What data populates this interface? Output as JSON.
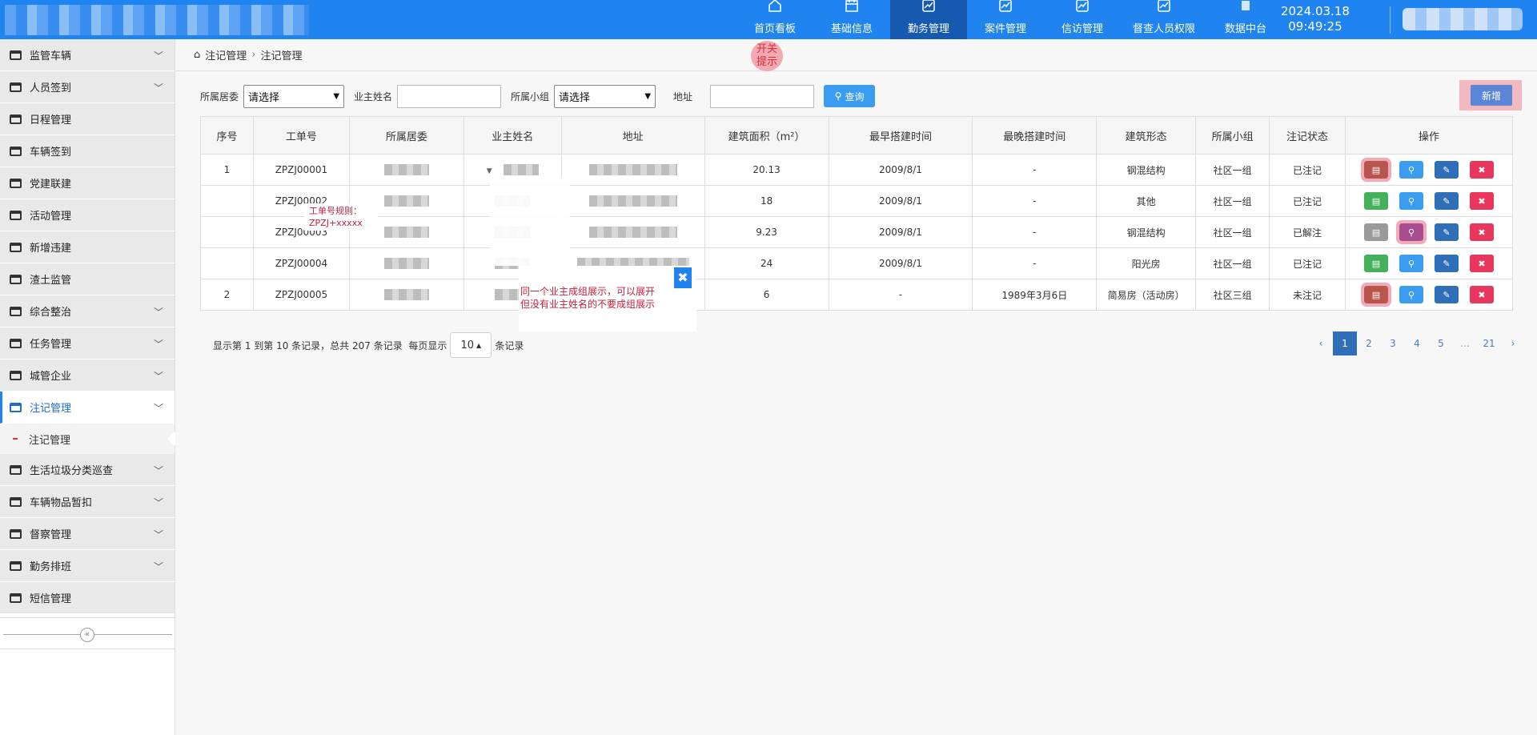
{
  "header": {
    "nav": [
      {
        "label": "首页看板",
        "icon": "home-icon"
      },
      {
        "label": "基础信息",
        "icon": "calendar-icon"
      },
      {
        "label": "勤务管理",
        "icon": "chart-icon",
        "active": true
      },
      {
        "label": "案件管理",
        "icon": "chart-icon"
      },
      {
        "label": "信访管理",
        "icon": "chart-icon"
      },
      {
        "label": "督查人员权限",
        "icon": "chart-icon"
      },
      {
        "label": "数据中台",
        "icon": "broken-image-icon"
      }
    ],
    "date": "2024.03.18",
    "time": "09:49:25"
  },
  "sidebar": {
    "items": [
      {
        "label": "监管车辆",
        "expandable": true
      },
      {
        "label": "人员签到",
        "expandable": true
      },
      {
        "label": "日程管理",
        "expandable": false
      },
      {
        "label": "车辆签到",
        "expandable": false
      },
      {
        "label": "党建联建",
        "expandable": false
      },
      {
        "label": "活动管理",
        "expandable": false
      },
      {
        "label": "新增违建",
        "expandable": false
      },
      {
        "label": "渣土监管",
        "expandable": false
      },
      {
        "label": "综合整治",
        "expandable": true
      },
      {
        "label": "任务管理",
        "expandable": true
      },
      {
        "label": "城管企业",
        "expandable": true
      },
      {
        "label": "注记管理",
        "expandable": true,
        "open": true
      },
      {
        "label": "生活垃圾分类巡查",
        "expandable": true
      },
      {
        "label": "车辆物品暂扣",
        "expandable": true
      },
      {
        "label": "督察管理",
        "expandable": true
      },
      {
        "label": "勤务排班",
        "expandable": true
      },
      {
        "label": "短信管理",
        "expandable": false
      }
    ],
    "sub_item": "注记管理"
  },
  "breadcrumb": [
    "注记管理",
    "注记管理"
  ],
  "switch_tip": "开关\n提示",
  "filters": {
    "community_label": "所属居委",
    "community_value": "请选择",
    "owner_label": "业主姓名",
    "group_label": "所属小组",
    "group_value": "请选择",
    "address_label": "地址",
    "query_label": "查询",
    "new_label": "新增"
  },
  "table": {
    "headers": [
      "序号",
      "工单号",
      "所属居委",
      "业主姓名",
      "地址",
      "建筑面积（m²）",
      "最早搭建时间",
      "最晚搭建时间",
      "建筑形态",
      "所属小组",
      "注记状态",
      "操作"
    ],
    "rows": [
      {
        "seq": "1",
        "order": "ZPZJ00001",
        "area": "20.13",
        "earliest": "2009/8/1",
        "latest": "-",
        "form": "钢混结构",
        "group": "社区一组",
        "status": "已注记"
      },
      {
        "seq": "",
        "order": "ZPZJ00002",
        "area": "18",
        "earliest": "2009/8/1",
        "latest": "-",
        "form": "其他",
        "group": "社区一组",
        "status": "已注记"
      },
      {
        "seq": "",
        "order": "ZPZJ00003",
        "area": "9.23",
        "earliest": "2009/8/1",
        "latest": "-",
        "form": "钢混结构",
        "group": "社区一组",
        "status": "已解注"
      },
      {
        "seq": "",
        "order": "ZPZJ00004",
        "area": "24",
        "earliest": "2009/8/1",
        "latest": "-",
        "form": "阳光房",
        "group": "社区一组",
        "status": "已注记"
      },
      {
        "seq": "2",
        "order": "ZPZJ00005",
        "area": "6",
        "earliest": "-",
        "latest": "1989年3月6日",
        "form": "简易房（活动房）",
        "group": "社区三组",
        "status": "未注记"
      }
    ]
  },
  "notes": {
    "order_rule": "工单号规则：\nZPZJ+xxxxx",
    "group_rule": "同一个业主成组展示，可以展开\n但没有业主姓名的不要成组展示",
    "close": "✖"
  },
  "pagination": {
    "info_prefix": "显示第 1 到第 10 条记录，总共 207 条记录  每页显示",
    "page_size": "10",
    "info_suffix": "条记录",
    "pages": [
      "‹",
      "1",
      "2",
      "3",
      "4",
      "5",
      "...",
      "21",
      "›"
    ],
    "active_page": "1"
  }
}
